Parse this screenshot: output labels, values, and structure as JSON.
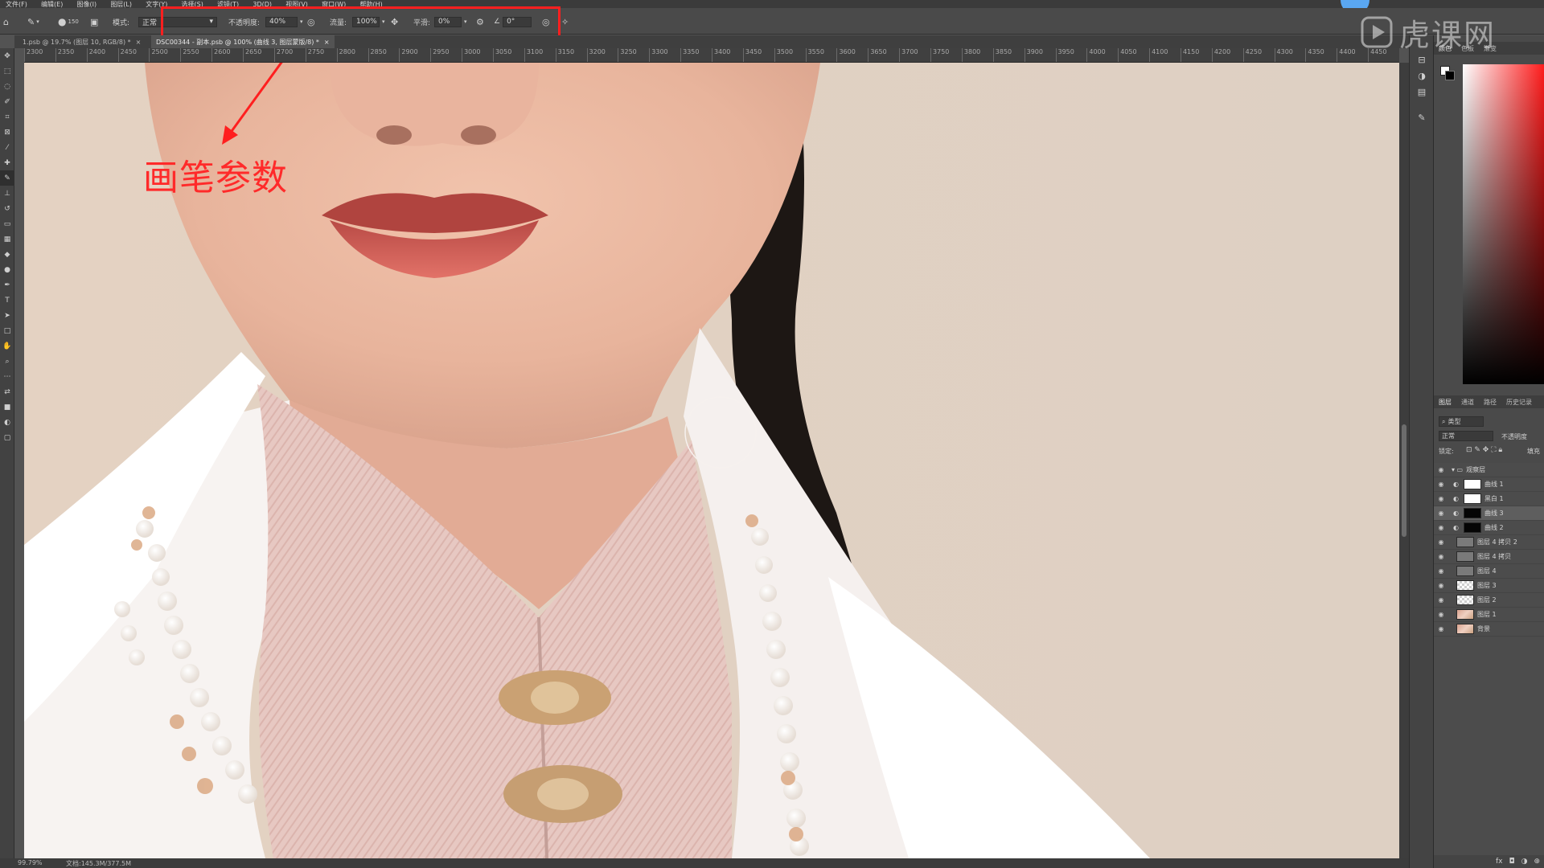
{
  "menubar": {
    "items": [
      "文件(F)",
      "编辑(E)",
      "图像(I)",
      "图层(L)",
      "文字(Y)",
      "选择(S)",
      "滤镜(T)",
      "3D(D)",
      "视图(V)",
      "窗口(W)",
      "帮助(H)"
    ]
  },
  "options": {
    "brush_size": "150",
    "mode_label": "模式:",
    "mode_value": "正常",
    "opacity_label": "不透明度:",
    "opacity_value": "40%",
    "flow_label": "流量:",
    "flow_value": "100%",
    "smoothing_label": "平滑:",
    "smoothing_value": "0%",
    "angle_value": "0°"
  },
  "tabs": [
    {
      "label": "1.psb @ 19.7% (图层 10, RGB/8) *"
    },
    {
      "label": "DSC00344 - 副本.psb @ 100% (曲线 3, 图层蒙版/8) *"
    }
  ],
  "ruler": {
    "ticks": [
      "2300",
      "2350",
      "2400",
      "2450",
      "2500",
      "2550",
      "2600",
      "2650",
      "2700",
      "2750",
      "2800",
      "2850",
      "2900",
      "2950",
      "3000",
      "3050",
      "3100",
      "3150",
      "3200",
      "3250",
      "3300",
      "3350",
      "3400",
      "3450",
      "3500",
      "3550",
      "3600",
      "3650",
      "3700",
      "3750",
      "3800",
      "3850",
      "3900",
      "3950",
      "4000",
      "4050",
      "4100",
      "4150",
      "4200",
      "4250",
      "4300",
      "4350",
      "4400",
      "4450"
    ]
  },
  "annotation": {
    "label": "画笔参数",
    "color": "#ff1f1f"
  },
  "watermark": {
    "text": "虎课网"
  },
  "statusbar": {
    "zoom": "99.79%",
    "doc": "文档:145.3M/377.5M"
  },
  "right_panel": {
    "top_tabs": [
      "颜色",
      "色板",
      "渐变"
    ],
    "layers_tabs": [
      "图层",
      "通道",
      "路径",
      "历史记录"
    ],
    "filter_label": "类型",
    "blend_mode": "正常",
    "opacity_label": "不透明度",
    "lock_label": "锁定:",
    "fill_label": "填充",
    "layers": [
      {
        "name": "观察层",
        "kind": "group",
        "selected": false
      },
      {
        "name": "曲线 1",
        "kind": "adjust-white",
        "selected": false
      },
      {
        "name": "黑白 1",
        "kind": "adjust-white",
        "selected": false
      },
      {
        "name": "曲线 3",
        "kind": "adjust-black",
        "selected": true
      },
      {
        "name": "曲线 2",
        "kind": "adjust-black",
        "selected": false
      },
      {
        "name": "图层 4 拷贝 2",
        "kind": "gray",
        "selected": false
      },
      {
        "name": "图层 4 拷贝",
        "kind": "gray",
        "selected": false
      },
      {
        "name": "图层 4",
        "kind": "gray",
        "selected": false
      },
      {
        "name": "图层 3",
        "kind": "checker",
        "selected": false
      },
      {
        "name": "图层 2",
        "kind": "checker",
        "selected": false
      },
      {
        "name": "图层 1",
        "kind": "photo",
        "selected": false
      },
      {
        "name": "背景",
        "kind": "photo",
        "selected": false
      }
    ]
  },
  "colors": {
    "annotation": "#ff1f1f",
    "panel_bg": "#4a4a4a",
    "canvas_bg": "#e9dccf"
  }
}
